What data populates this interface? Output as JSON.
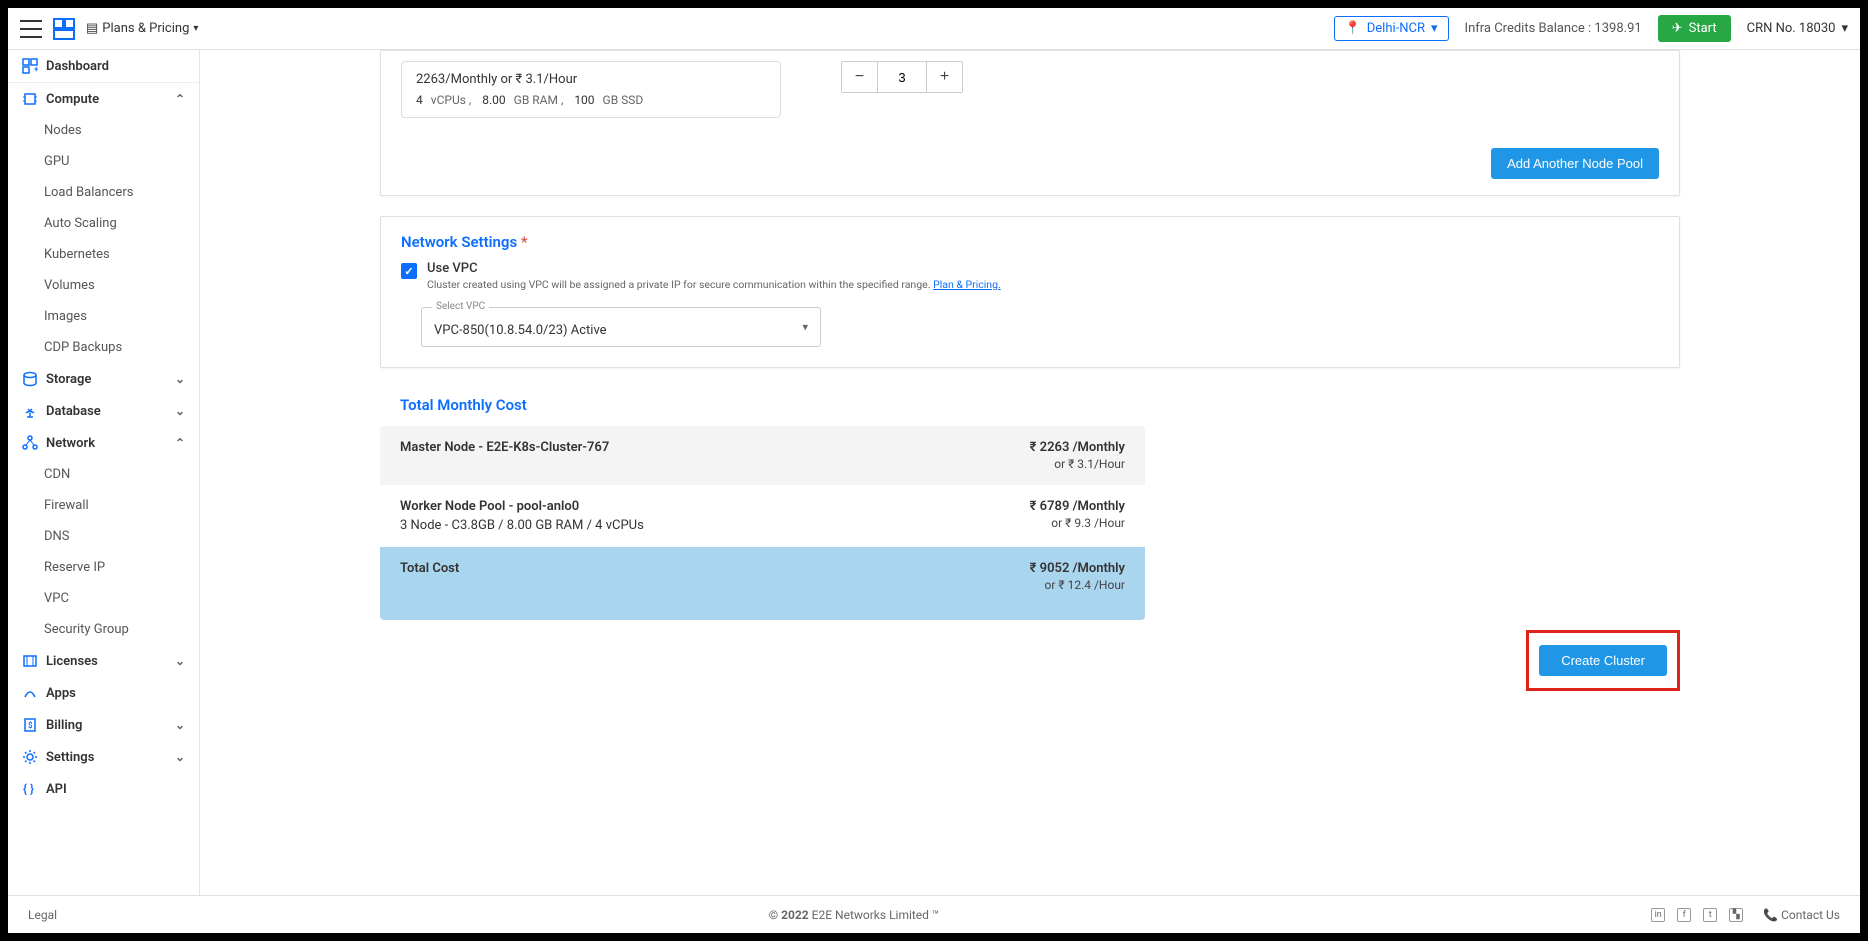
{
  "topbar": {
    "plans_label": "Plans & Pricing",
    "region": "Delhi-NCR",
    "credits_label": "Infra Credits Balance : 1398.91",
    "start_label": "Start",
    "crn_label": "CRN No. 18030"
  },
  "sidebar": {
    "dashboard": "Dashboard",
    "compute": "Compute",
    "compute_children": [
      "Nodes",
      "GPU",
      "Load Balancers",
      "Auto Scaling",
      "Kubernetes",
      "Volumes",
      "Images",
      "CDP Backups"
    ],
    "storage": "Storage",
    "database": "Database",
    "network": "Network",
    "network_children": [
      "CDN",
      "Firewall",
      "DNS",
      "Reserve IP",
      "VPC",
      "Security Group"
    ],
    "licenses": "Licenses",
    "apps": "Apps",
    "billing": "Billing",
    "settings": "Settings",
    "api": "API"
  },
  "pool": {
    "price_line": "2263/Monthly or ₹ 3.1/Hour",
    "spec_cpu_n": "4",
    "spec_cpu_l": "vCPUs ,",
    "spec_ram_n": "8.00",
    "spec_ram_l": "GB RAM ,",
    "spec_ssd_n": "100",
    "spec_ssd_l": "GB SSD",
    "qty": "3",
    "add_btn": "Add Another Node Pool"
  },
  "network": {
    "title": "Network Settings",
    "use_vpc": "Use VPC",
    "desc": "Cluster created using VPC will be assigned a private IP for secure communication within the specified range.",
    "plan_link": "Plan & Pricing.",
    "select_lbl": "Select VPC",
    "select_val": "VPC-850(10.8.54.0/23) Active"
  },
  "cost": {
    "title": "Total Monthly Cost",
    "master_label": "Master Node - E2E-K8s-Cluster-767",
    "master_price": "₹ 2263 /Monthly",
    "master_hour": "or ₹ 3.1/Hour",
    "worker_label": "Worker Node Pool - pool-anlo0",
    "worker_spec": "3 Node - C3.8GB / 8.00 GB RAM / 4 vCPUs",
    "worker_price": "₹ 6789 /Monthly",
    "worker_hour": "or ₹ 9.3 /Hour",
    "total_label": "Total Cost",
    "total_price": "₹ 9052 /Monthly",
    "total_hour": "or ₹ 12.4 /Hour",
    "create_btn": "Create Cluster"
  },
  "footer": {
    "legal": "Legal",
    "copy_bold": "© 2022",
    "copy_rest": "E2E Networks Limited ™",
    "contact": "Contact Us"
  }
}
